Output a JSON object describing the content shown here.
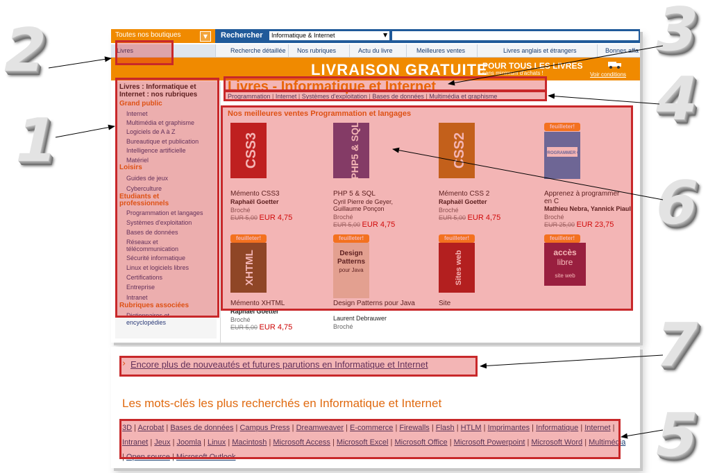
{
  "header": {
    "shop_select": "Toutes nos boutiques",
    "search_label": "Rechercher",
    "search_category": "Informatique & Internet",
    "nav_current": "Livres",
    "nav": [
      "Recherche détaillée",
      "Nos rubriques",
      "Actu du livre",
      "Meilleures ventes",
      "Livres anglais et étrangers",
      "Bonnes affa"
    ]
  },
  "promo": {
    "big": "LIVRAISON GRATUITE",
    "line1": "POUR TOUS LES LIVRES",
    "line2": "sans minimum d'achats !",
    "link": "Voir conditions"
  },
  "sidebar": {
    "title": "Livres : Informatique et Internet : nos rubriques",
    "groups": [
      {
        "name": "Grand public",
        "items": [
          "Internet",
          "Multimédia et graphisme",
          "Logiciels de A à Z",
          "Bureautique et publication",
          "Intelligence artificielle",
          "Matériel"
        ]
      },
      {
        "name": "Loisirs",
        "items": [
          "Guides de jeux",
          "Cyberculture"
        ]
      },
      {
        "name": "Etudiants et professionnels",
        "items": [
          "Programmation et langages",
          "Systèmes d'exploitation",
          "Bases de données",
          "Réseaux et télécommunication",
          "Sécurité informatique",
          "Linux et logiciels libres",
          "Certifications",
          "Entreprise",
          "Intranet"
        ]
      },
      {
        "name": "Rubriques associées",
        "items": [
          "Dictionnaires et encyclopédies"
        ]
      }
    ]
  },
  "main": {
    "title": "Livres - Informatique et Internet",
    "breadcrumb": [
      "Programmation",
      "Internet",
      "Systèmes d'exploitation",
      "Bases de données",
      "Multimédia et graphisme"
    ],
    "best_title": "Nos meilleures ventes Programmation et langages",
    "feuilleter": "feuilleter!",
    "books": [
      {
        "title1": "Mémento CSS3",
        "title2": "",
        "author1": "Raphaël Goetter",
        "author2": "",
        "format": "Broché",
        "old_price": "EUR 5,00",
        "price": "EUR 4,75",
        "cover_text": "CSS3",
        "cover_color": "#b22222"
      },
      {
        "title1": "PHP 5 & SQL",
        "title2": "",
        "author1": "Cyril Pierre de Geyer,",
        "author2": "Guillaume Ponçon",
        "format": "Broché",
        "old_price": "EUR 5,00",
        "price": "EUR 4,75",
        "cover_text": "PHP5 & SQL",
        "cover_color": "#5a4a8a"
      },
      {
        "title1": "Mémento CSS 2",
        "title2": "",
        "author1": "Raphaël Goetter",
        "author2": "",
        "format": "Broché",
        "old_price": "EUR 5,00",
        "price": "EUR 4,75",
        "cover_text": "CSS2",
        "cover_color": "#b8801a"
      },
      {
        "title1": "Apprenez à programmer",
        "title2": "en C",
        "author1": "Mathieu Nebra, Yannick Piault",
        "author2": "",
        "format": "Broché",
        "old_price": "EUR 25,00",
        "price": "EUR 23,75",
        "cover_text": "APPRENEZ A PROGRAMMER EN C",
        "cover_color": "#3a8ad0"
      },
      {
        "title1": "Mémento XHTML",
        "title2": "",
        "author1": "Raphaël Goetter",
        "author2": "",
        "format": "Broché",
        "old_price": "EUR 5,00",
        "price": "EUR 4,75",
        "cover_text": "XHTML",
        "cover_color": "#6a5a2a"
      },
      {
        "title1": "Design Patterns pour Java",
        "title2": "",
        "author1": "Laurent Debrauwer",
        "author2": "",
        "format": "Broché",
        "old_price": "",
        "price": "",
        "cover_text": "Design Patterns pour Java",
        "cover_color": "#e8e0c8"
      },
      {
        "title1": "Site",
        "title2": "",
        "author1": "",
        "author2": "",
        "format": "",
        "old_price": "",
        "price": "",
        "cover_text": "Sites web",
        "cover_color": "#a02020"
      },
      {
        "title1": "",
        "title2": "",
        "author1": "",
        "author2": "",
        "format": "",
        "old_price": "",
        "price": "",
        "cover_text": "accès libre site web XHTML et CSS",
        "cover_color": "#7a2050"
      }
    ]
  },
  "footer": {
    "more_link": "Encore plus de nouveautés et futures parutions en Informatique et Internet",
    "kw_title": "Les mots-clés les plus recherchés en Informatique et Internet",
    "keywords": [
      "3D",
      "Acrobat",
      "Bases de données",
      "Campus Press",
      "Dreamweaver",
      "E-commerce",
      "Firewalls",
      "Flash",
      "HTLM",
      "Imprimantes",
      "Informatique",
      "Internet",
      "Intranet",
      "Jeux",
      "Joomla",
      "Linux",
      "Macintosh",
      "Microsoft Access",
      "Microsoft Excel",
      "Microsoft Office",
      "Microsoft Powerpoint",
      "Microsoft Word",
      "Multimédia",
      "Open source",
      "Microsoft Outlook"
    ]
  },
  "callouts": [
    "1",
    "2",
    "3",
    "4",
    "5",
    "6",
    "7"
  ],
  "colors": {
    "orange": "#f08a00",
    "blue": "#205a9a",
    "highlight": "#c8282a"
  }
}
